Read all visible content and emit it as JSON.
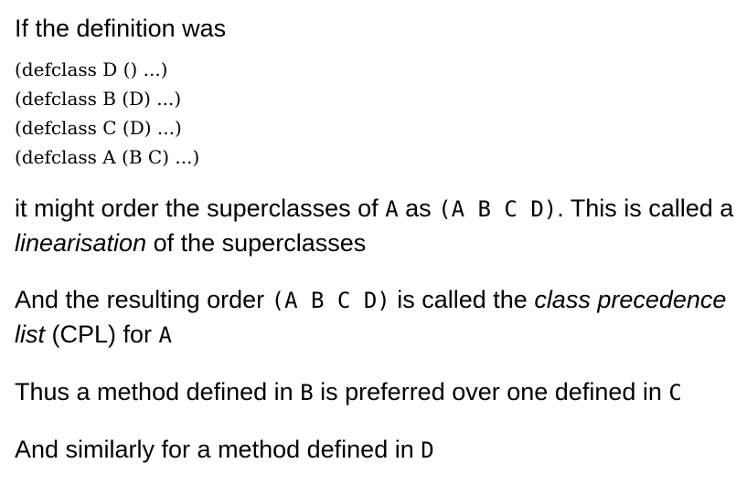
{
  "intro": "If the definition was",
  "code_lines": [
    "(defclass D () ...)",
    "(defclass B (D) ...)",
    "(defclass C (D) ...)",
    "(defclass A (B C) ...)"
  ],
  "p1": {
    "t1": "it might order the superclasses of ",
    "c1": "A",
    "t2": " as ",
    "c2": "(A B C D)",
    "t3": ". This is called a ",
    "em1": "linearisation",
    "t4": " of the superclasses"
  },
  "p2": {
    "t1": "And the resulting order ",
    "c1": "(A B C D)",
    "t2": " is called the ",
    "em1": "class precedence list",
    "t3": " (CPL) for ",
    "c2": "A"
  },
  "p3": {
    "t1": "Thus a method defined in ",
    "c1": "B",
    "t2": " is preferred over one defined in ",
    "c2": "C"
  },
  "p4": {
    "t1": "And similarly for a method defined in ",
    "c1": "D"
  }
}
